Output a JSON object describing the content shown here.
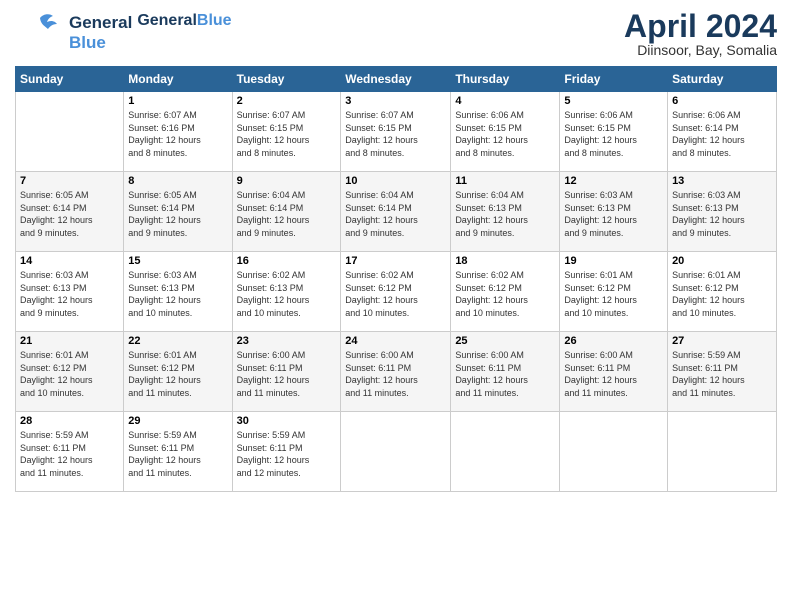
{
  "header": {
    "logo_line1": "General",
    "logo_line2": "Blue",
    "month": "April 2024",
    "location": "Diinsoor, Bay, Somalia"
  },
  "weekdays": [
    "Sunday",
    "Monday",
    "Tuesday",
    "Wednesday",
    "Thursday",
    "Friday",
    "Saturday"
  ],
  "weeks": [
    [
      {
        "day": "",
        "info": ""
      },
      {
        "day": "1",
        "info": "Sunrise: 6:07 AM\nSunset: 6:16 PM\nDaylight: 12 hours\nand 8 minutes."
      },
      {
        "day": "2",
        "info": "Sunrise: 6:07 AM\nSunset: 6:15 PM\nDaylight: 12 hours\nand 8 minutes."
      },
      {
        "day": "3",
        "info": "Sunrise: 6:07 AM\nSunset: 6:15 PM\nDaylight: 12 hours\nand 8 minutes."
      },
      {
        "day": "4",
        "info": "Sunrise: 6:06 AM\nSunset: 6:15 PM\nDaylight: 12 hours\nand 8 minutes."
      },
      {
        "day": "5",
        "info": "Sunrise: 6:06 AM\nSunset: 6:15 PM\nDaylight: 12 hours\nand 8 minutes."
      },
      {
        "day": "6",
        "info": "Sunrise: 6:06 AM\nSunset: 6:14 PM\nDaylight: 12 hours\nand 8 minutes."
      }
    ],
    [
      {
        "day": "7",
        "info": "Sunrise: 6:05 AM\nSunset: 6:14 PM\nDaylight: 12 hours\nand 9 minutes."
      },
      {
        "day": "8",
        "info": "Sunrise: 6:05 AM\nSunset: 6:14 PM\nDaylight: 12 hours\nand 9 minutes."
      },
      {
        "day": "9",
        "info": "Sunrise: 6:04 AM\nSunset: 6:14 PM\nDaylight: 12 hours\nand 9 minutes."
      },
      {
        "day": "10",
        "info": "Sunrise: 6:04 AM\nSunset: 6:14 PM\nDaylight: 12 hours\nand 9 minutes."
      },
      {
        "day": "11",
        "info": "Sunrise: 6:04 AM\nSunset: 6:13 PM\nDaylight: 12 hours\nand 9 minutes."
      },
      {
        "day": "12",
        "info": "Sunrise: 6:03 AM\nSunset: 6:13 PM\nDaylight: 12 hours\nand 9 minutes."
      },
      {
        "day": "13",
        "info": "Sunrise: 6:03 AM\nSunset: 6:13 PM\nDaylight: 12 hours\nand 9 minutes."
      }
    ],
    [
      {
        "day": "14",
        "info": "Sunrise: 6:03 AM\nSunset: 6:13 PM\nDaylight: 12 hours\nand 9 minutes."
      },
      {
        "day": "15",
        "info": "Sunrise: 6:03 AM\nSunset: 6:13 PM\nDaylight: 12 hours\nand 10 minutes."
      },
      {
        "day": "16",
        "info": "Sunrise: 6:02 AM\nSunset: 6:13 PM\nDaylight: 12 hours\nand 10 minutes."
      },
      {
        "day": "17",
        "info": "Sunrise: 6:02 AM\nSunset: 6:12 PM\nDaylight: 12 hours\nand 10 minutes."
      },
      {
        "day": "18",
        "info": "Sunrise: 6:02 AM\nSunset: 6:12 PM\nDaylight: 12 hours\nand 10 minutes."
      },
      {
        "day": "19",
        "info": "Sunrise: 6:01 AM\nSunset: 6:12 PM\nDaylight: 12 hours\nand 10 minutes."
      },
      {
        "day": "20",
        "info": "Sunrise: 6:01 AM\nSunset: 6:12 PM\nDaylight: 12 hours\nand 10 minutes."
      }
    ],
    [
      {
        "day": "21",
        "info": "Sunrise: 6:01 AM\nSunset: 6:12 PM\nDaylight: 12 hours\nand 10 minutes."
      },
      {
        "day": "22",
        "info": "Sunrise: 6:01 AM\nSunset: 6:12 PM\nDaylight: 12 hours\nand 11 minutes."
      },
      {
        "day": "23",
        "info": "Sunrise: 6:00 AM\nSunset: 6:11 PM\nDaylight: 12 hours\nand 11 minutes."
      },
      {
        "day": "24",
        "info": "Sunrise: 6:00 AM\nSunset: 6:11 PM\nDaylight: 12 hours\nand 11 minutes."
      },
      {
        "day": "25",
        "info": "Sunrise: 6:00 AM\nSunset: 6:11 PM\nDaylight: 12 hours\nand 11 minutes."
      },
      {
        "day": "26",
        "info": "Sunrise: 6:00 AM\nSunset: 6:11 PM\nDaylight: 12 hours\nand 11 minutes."
      },
      {
        "day": "27",
        "info": "Sunrise: 5:59 AM\nSunset: 6:11 PM\nDaylight: 12 hours\nand 11 minutes."
      }
    ],
    [
      {
        "day": "28",
        "info": "Sunrise: 5:59 AM\nSunset: 6:11 PM\nDaylight: 12 hours\nand 11 minutes."
      },
      {
        "day": "29",
        "info": "Sunrise: 5:59 AM\nSunset: 6:11 PM\nDaylight: 12 hours\nand 11 minutes."
      },
      {
        "day": "30",
        "info": "Sunrise: 5:59 AM\nSunset: 6:11 PM\nDaylight: 12 hours\nand 12 minutes."
      },
      {
        "day": "",
        "info": ""
      },
      {
        "day": "",
        "info": ""
      },
      {
        "day": "",
        "info": ""
      },
      {
        "day": "",
        "info": ""
      }
    ]
  ]
}
